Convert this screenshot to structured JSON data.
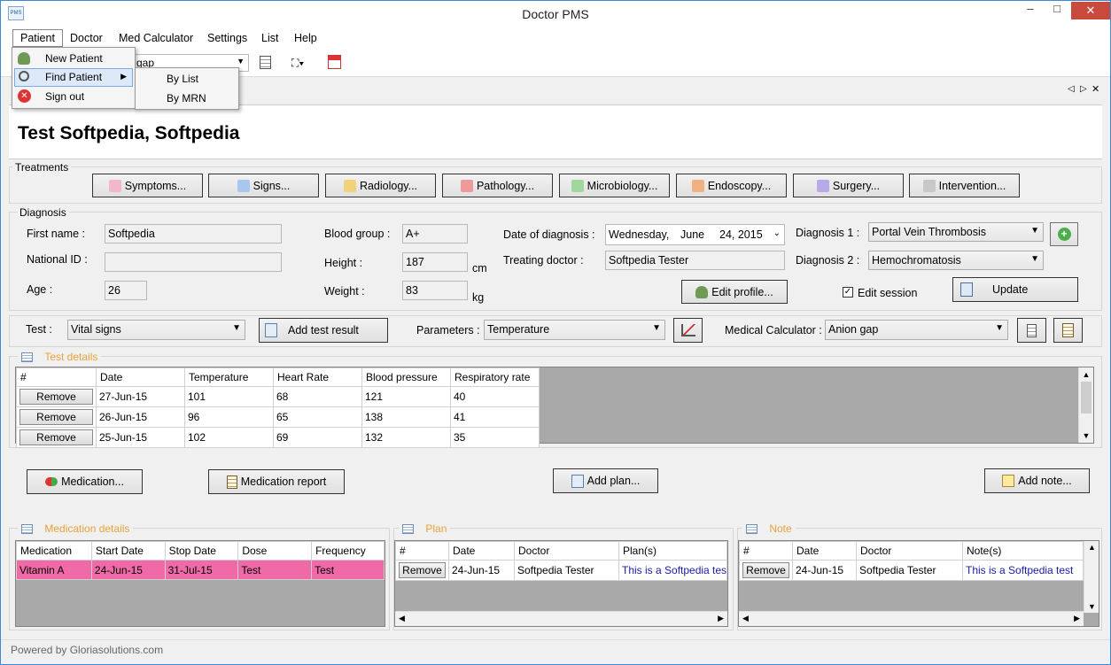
{
  "window": {
    "title": "Doctor PMS",
    "minimize": "–",
    "maximize": "□",
    "close": "✕"
  },
  "menu": {
    "items": [
      "Patient",
      "Doctor",
      "Med Calculator",
      "Settings",
      "List",
      "Help"
    ]
  },
  "patient_menu": {
    "new": "New Patient",
    "find": "Find Patient",
    "signout": "Sign out",
    "sub_by_list": "By List",
    "sub_by_mrn": "By MRN"
  },
  "toolbar": {
    "partial_text": "gap"
  },
  "patient_name": "Test Softpedia, Softpedia",
  "treatments": {
    "label": "Treatments",
    "buttons": [
      "Symptoms...",
      "Signs...",
      "Radiology...",
      "Pathology...",
      "Microbiology...",
      "Endoscopy...",
      "Surgery...",
      "Intervention..."
    ]
  },
  "diagnosis": {
    "label": "Diagnosis",
    "first_name_label": "First name :",
    "first_name": "Softpedia",
    "national_id_label": "National ID :",
    "national_id": "",
    "age_label": "Age :",
    "age": "26",
    "blood_group_label": "Blood group :",
    "blood_group": "A+",
    "height_label": "Height :",
    "height": "187",
    "height_unit": "cm",
    "weight_label": "Weight :",
    "weight": "83",
    "weight_unit": "kg",
    "date_label": "Date of diagnosis :",
    "date_day": "Wednesday,",
    "date_month": "June",
    "date_rest": "24, 2015",
    "doctor_label": "Treating doctor :",
    "doctor": "Softpedia Tester",
    "diag1_label": "Diagnosis 1 :",
    "diag1": "Portal Vein Thrombosis",
    "diag2_label": "Diagnosis 2 :",
    "diag2": "Hemochromatosis",
    "edit_profile": "Edit profile...",
    "edit_session": "Edit session",
    "update": "Update"
  },
  "test_bar": {
    "test_label": "Test :",
    "test_value": "Vital signs",
    "add_result": "Add test result",
    "params_label": "Parameters :",
    "params_value": "Temperature",
    "calc_label": "Medical Calculator :",
    "calc_value": "Anion gap"
  },
  "test_details": {
    "title": "Test details",
    "columns": [
      "#",
      "Date",
      "Temperature",
      "Heart Rate",
      "Blood pressure",
      "Respiratory rate"
    ],
    "remove_label": "Remove",
    "rows": [
      [
        "27-Jun-15",
        "101",
        "68",
        "121",
        "40"
      ],
      [
        "26-Jun-15",
        "96",
        "65",
        "138",
        "41"
      ],
      [
        "25-Jun-15",
        "102",
        "69",
        "132",
        "35"
      ]
    ]
  },
  "actions": {
    "medication": "Medication...",
    "medication_report": "Medication report",
    "add_plan": "Add plan...",
    "add_note": "Add note..."
  },
  "medication_details": {
    "title": "Medication details",
    "columns": [
      "Medication",
      "Start Date",
      "Stop Date",
      "Dose",
      "Frequency"
    ],
    "rows": [
      [
        "Vitamin A",
        "24-Jun-15",
        "31-Jul-15",
        "Test",
        "Test"
      ]
    ]
  },
  "plan": {
    "title": "Plan",
    "columns": [
      "#",
      "Date",
      "Doctor",
      "Plan(s)"
    ],
    "remove_label": "Remove",
    "rows": [
      [
        "24-Jun-15",
        "Softpedia Tester",
        "This is a Softpedia test"
      ]
    ]
  },
  "note": {
    "title": "Note",
    "columns": [
      "#",
      "Date",
      "Doctor",
      "Note(s)"
    ],
    "remove_label": "Remove",
    "rows": [
      [
        "24-Jun-15",
        "Softpedia Tester",
        "This is a Softpedia test"
      ]
    ]
  },
  "status": "Powered by Gloriasolutions.com",
  "colors": {
    "accent": "#e8a23a",
    "highlight_row": "#f06aa8",
    "link_text": "#1a1aa8",
    "title_border": "#3c8ad6"
  }
}
